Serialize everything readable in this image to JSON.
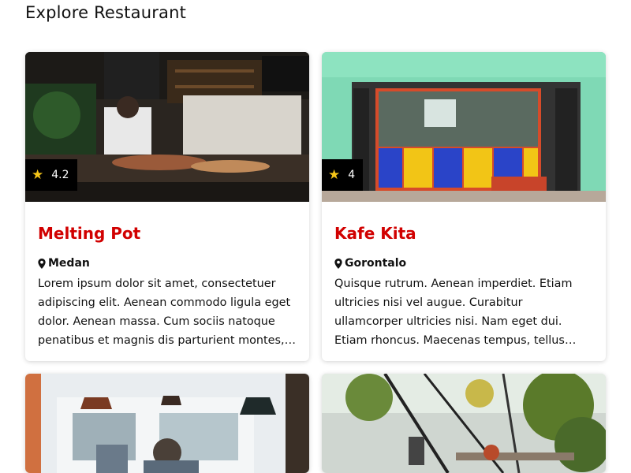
{
  "page": {
    "title": "Explore Restaurant"
  },
  "restaurants": [
    {
      "name": "Melting Pot",
      "rating": "4.2",
      "city": "Medan",
      "description": "Lorem ipsum dolor sit amet, consectetuer adipiscing elit. Aenean commodo ligula eget dolor. Aenean massa. Cum sociis natoque penatibus et magnis dis parturient montes, nascetur ridiculus mus."
    },
    {
      "name": "Kafe Kita",
      "rating": "4",
      "city": "Gorontalo",
      "description": "Quisque rutrum. Aenean imperdiet. Etiam ultricies nisi vel augue. Curabitur ullamcorper ultricies nisi. Nam eget dui. Etiam rhoncus. Maecenas tempus, tellus eget condimentum rhoncus."
    }
  ],
  "colors": {
    "title_accent": "#d10000",
    "star": "#f5c518"
  },
  "icons": {
    "rating": "star-icon",
    "location": "map-pin-icon"
  }
}
